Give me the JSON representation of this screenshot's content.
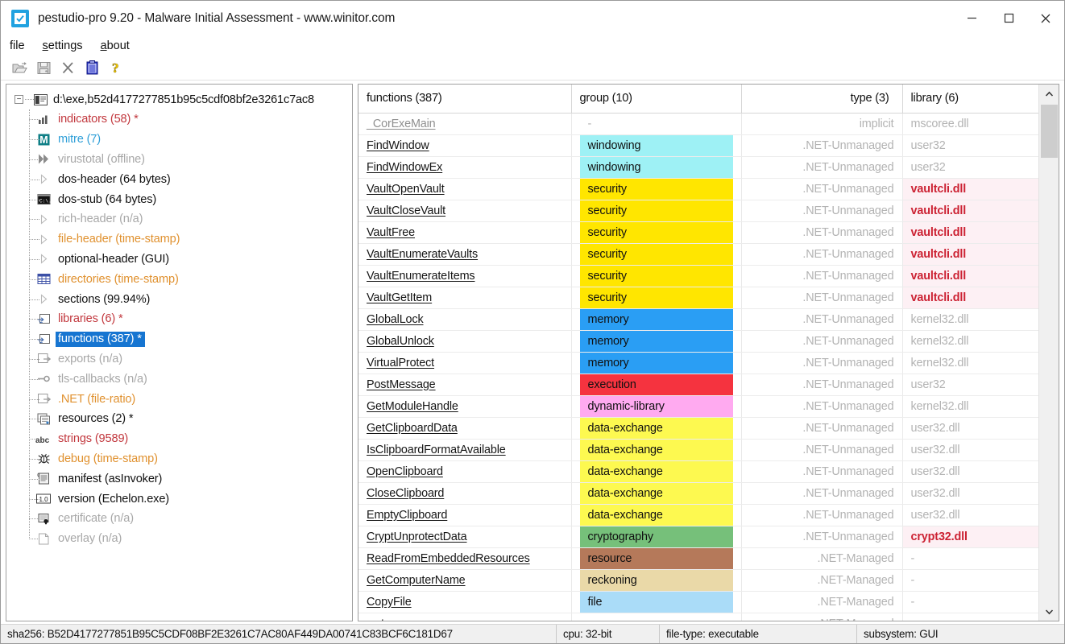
{
  "window": {
    "title": "pestudio-pro 9.20 - Malware Initial Assessment - www.winitor.com",
    "app_icon": "checkbox-checked-icon",
    "minimize_label": "—",
    "maximize_label": "□",
    "close_label": "✕"
  },
  "menubar": {
    "items": [
      {
        "label": "file",
        "accel": ""
      },
      {
        "label": "settings",
        "accel": "s"
      },
      {
        "label": "about",
        "accel": "a"
      }
    ]
  },
  "toolbar": {
    "buttons": [
      {
        "name": "open-file-icon",
        "enabled": false
      },
      {
        "name": "save-icon",
        "enabled": false
      },
      {
        "name": "close-file-icon",
        "enabled": false
      },
      {
        "name": "clipboard-icon",
        "enabled": true
      },
      {
        "name": "help-icon",
        "enabled": true
      }
    ]
  },
  "tree": {
    "root": {
      "label": "d:\\exe,b52d4177277851b95c5cdf08bf2e3261c7ac8",
      "expanded": true
    },
    "items": [
      {
        "label": "indicators (58) *",
        "color": "red",
        "icon": "bar-chart-icon",
        "selected": false
      },
      {
        "label": "mitre (7)",
        "color": "blue",
        "icon": "mitre-m-icon",
        "selected": false
      },
      {
        "label": "virustotal (offline)",
        "color": "gray",
        "icon": "double-chevron-icon",
        "selected": false
      },
      {
        "label": "dos-header (64 bytes)",
        "color": "dark",
        "icon": "triangle-icon",
        "selected": false
      },
      {
        "label": "dos-stub (64 bytes)",
        "color": "dark",
        "icon": "console-icon",
        "selected": false
      },
      {
        "label": "rich-header (n/a)",
        "color": "gray",
        "icon": "triangle-icon",
        "selected": false
      },
      {
        "label": "file-header (time-stamp)",
        "color": "orange",
        "icon": "triangle-icon",
        "selected": false
      },
      {
        "label": "optional-header (GUI)",
        "color": "dark",
        "icon": "triangle-icon",
        "selected": false
      },
      {
        "label": "directories (time-stamp)",
        "color": "orange",
        "icon": "grid-icon",
        "selected": false
      },
      {
        "label": "sections (99.94%)",
        "color": "dark",
        "icon": "triangle-icon",
        "selected": false
      },
      {
        "label": "libraries (6) *",
        "color": "red",
        "icon": "import-icon",
        "selected": false
      },
      {
        "label": "functions (387) *",
        "color": "dark",
        "icon": "import-icon",
        "selected": true
      },
      {
        "label": "exports (n/a)",
        "color": "gray",
        "icon": "export-icon",
        "selected": false
      },
      {
        "label": "tls-callbacks (n/a)",
        "color": "gray",
        "icon": "callback-icon",
        "selected": false
      },
      {
        "label": ".NET (file-ratio)",
        "color": "orange",
        "icon": "export-icon",
        "selected": false
      },
      {
        "label": "resources (2) *",
        "color": "dark",
        "icon": "resources-icon",
        "selected": false
      },
      {
        "label": "strings (9589)",
        "color": "red",
        "icon": "abc-icon",
        "selected": false
      },
      {
        "label": "debug (time-stamp)",
        "color": "orange",
        "icon": "bug-icon",
        "selected": false
      },
      {
        "label": "manifest (asInvoker)",
        "color": "dark",
        "icon": "manifest-icon",
        "selected": false
      },
      {
        "label": "version (Echelon.exe)",
        "color": "dark",
        "icon": "version-icon",
        "selected": false
      },
      {
        "label": "certificate (n/a)",
        "color": "gray",
        "icon": "certificate-icon",
        "selected": false
      },
      {
        "label": "overlay (n/a)",
        "color": "gray",
        "icon": "page-icon",
        "selected": false
      }
    ]
  },
  "table": {
    "headers": {
      "functions": "functions (387)",
      "group": "group (10)",
      "type": "type (3)",
      "library": "library (6)"
    },
    "group_colors": {
      "windowing": "#9ef1f5",
      "security": "#ffe600",
      "memory": "#2a9ef4",
      "execution": "#f5333f",
      "dynamic-library": "#ffaaf0",
      "data-exchange": "#fdf950",
      "cryptography": "#76c07a",
      "resource": "#b5795a",
      "reckoning": "#ead9a8",
      "file": "#aadcf8",
      "-": "transparent"
    },
    "rows": [
      {
        "function": "_CorExeMain",
        "group": "-",
        "type": "implicit",
        "library": "mscoree.dll",
        "dim": true,
        "alert": false
      },
      {
        "function": "FindWindow",
        "group": "windowing",
        "type": ".NET-Unmanaged",
        "library": "user32",
        "dim": false,
        "alert": false
      },
      {
        "function": "FindWindowEx",
        "group": "windowing",
        "type": ".NET-Unmanaged",
        "library": "user32",
        "dim": false,
        "alert": false
      },
      {
        "function": "VaultOpenVault",
        "group": "security",
        "type": ".NET-Unmanaged",
        "library": "vaultcli.dll",
        "dim": false,
        "alert": true
      },
      {
        "function": "VaultCloseVault",
        "group": "security",
        "type": ".NET-Unmanaged",
        "library": "vaultcli.dll",
        "dim": false,
        "alert": true
      },
      {
        "function": "VaultFree",
        "group": "security",
        "type": ".NET-Unmanaged",
        "library": "vaultcli.dll",
        "dim": false,
        "alert": true
      },
      {
        "function": "VaultEnumerateVaults",
        "group": "security",
        "type": ".NET-Unmanaged",
        "library": "vaultcli.dll",
        "dim": false,
        "alert": true
      },
      {
        "function": "VaultEnumerateItems",
        "group": "security",
        "type": ".NET-Unmanaged",
        "library": "vaultcli.dll",
        "dim": false,
        "alert": true
      },
      {
        "function": "VaultGetItem",
        "group": "security",
        "type": ".NET-Unmanaged",
        "library": "vaultcli.dll",
        "dim": false,
        "alert": true
      },
      {
        "function": "GlobalLock",
        "group": "memory",
        "type": ".NET-Unmanaged",
        "library": "kernel32.dll",
        "dim": false,
        "alert": false
      },
      {
        "function": "GlobalUnlock",
        "group": "memory",
        "type": ".NET-Unmanaged",
        "library": "kernel32.dll",
        "dim": false,
        "alert": false
      },
      {
        "function": "VirtualProtect",
        "group": "memory",
        "type": ".NET-Unmanaged",
        "library": "kernel32.dll",
        "dim": false,
        "alert": false
      },
      {
        "function": "PostMessage",
        "group": "execution",
        "type": ".NET-Unmanaged",
        "library": "user32",
        "dim": false,
        "alert": false
      },
      {
        "function": "GetModuleHandle",
        "group": "dynamic-library",
        "type": ".NET-Unmanaged",
        "library": "kernel32.dll",
        "dim": false,
        "alert": false
      },
      {
        "function": "GetClipboardData",
        "group": "data-exchange",
        "type": ".NET-Unmanaged",
        "library": "user32.dll",
        "dim": false,
        "alert": false
      },
      {
        "function": "IsClipboardFormatAvailable",
        "group": "data-exchange",
        "type": ".NET-Unmanaged",
        "library": "user32.dll",
        "dim": false,
        "alert": false
      },
      {
        "function": "OpenClipboard",
        "group": "data-exchange",
        "type": ".NET-Unmanaged",
        "library": "user32.dll",
        "dim": false,
        "alert": false
      },
      {
        "function": "CloseClipboard",
        "group": "data-exchange",
        "type": ".NET-Unmanaged",
        "library": "user32.dll",
        "dim": false,
        "alert": false
      },
      {
        "function": "EmptyClipboard",
        "group": "data-exchange",
        "type": ".NET-Unmanaged",
        "library": "user32.dll",
        "dim": false,
        "alert": false
      },
      {
        "function": "CryptUnprotectData",
        "group": "cryptography",
        "type": ".NET-Unmanaged",
        "library": "crypt32.dll",
        "dim": false,
        "alert": true
      },
      {
        "function": "ReadFromEmbeddedResources",
        "group": "resource",
        "type": ".NET-Managed",
        "library": "-",
        "dim": false,
        "alert": false
      },
      {
        "function": "GetComputerName",
        "group": "reckoning",
        "type": ".NET-Managed",
        "library": "-",
        "dim": false,
        "alert": false
      },
      {
        "function": "CopyFile",
        "group": "file",
        "type": ".NET-Managed",
        "library": "-",
        "dim": false,
        "alert": false
      },
      {
        "function": ".cctor",
        "group": "-",
        "type": ".NET-Managed",
        "library": "-",
        "dim": false,
        "alert": false
      }
    ]
  },
  "statusbar": {
    "sha256": "sha256: B52D4177277851B95C5CDF08BF2E3261C7AC80AF449DA00741C83BCF6C181D67",
    "cpu": "cpu: 32-bit",
    "file_type": "file-type: executable",
    "subsystem": "subsystem: GUI"
  }
}
